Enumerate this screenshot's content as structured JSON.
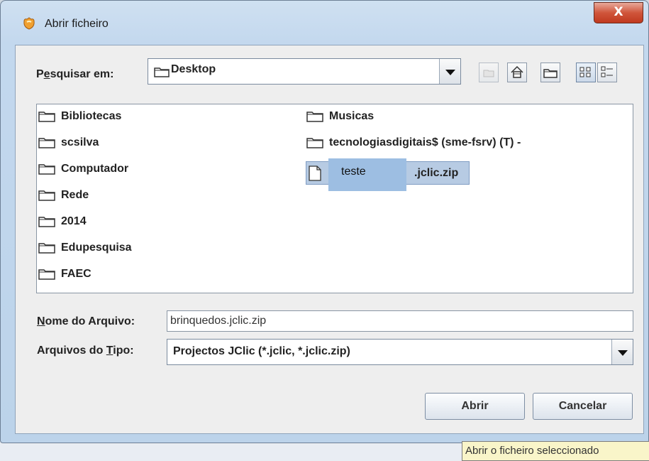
{
  "window": {
    "title": "Abrir ficheiro",
    "close_label": "X"
  },
  "look_in": {
    "label_pre": "P",
    "label_u": "e",
    "label_post": "squisar em:",
    "value": "Desktop"
  },
  "toolbar": {
    "icons": [
      "up-folder-icon",
      "home-icon",
      "new-folder-icon",
      "list-view-icon",
      "details-view-icon"
    ]
  },
  "files": {
    "left_column": [
      "Bibliotecas",
      "scsilva",
      "Computador",
      "Rede",
      "2014",
      "Edupesquisa",
      "FAEC"
    ],
    "right_column": [
      "Musicas",
      "tecnologiasdigitais$ (sme-fsrv) (T) -",
      ".jclic.zip"
    ],
    "selected_overlay": "teste"
  },
  "filename": {
    "label_u": "N",
    "label_post": "ome do Arquivo:",
    "value": "brinquedos.jclic.zip"
  },
  "filetype": {
    "label_pre": "Arquivos do ",
    "label_u": "T",
    "label_post": "ipo:",
    "value": "Projectos JClic (*.jclic, *.jclic.zip)"
  },
  "buttons": {
    "open": "Abrir",
    "cancel": "Cancelar"
  },
  "tooltip": "Abrir o ficheiro seleccionado"
}
